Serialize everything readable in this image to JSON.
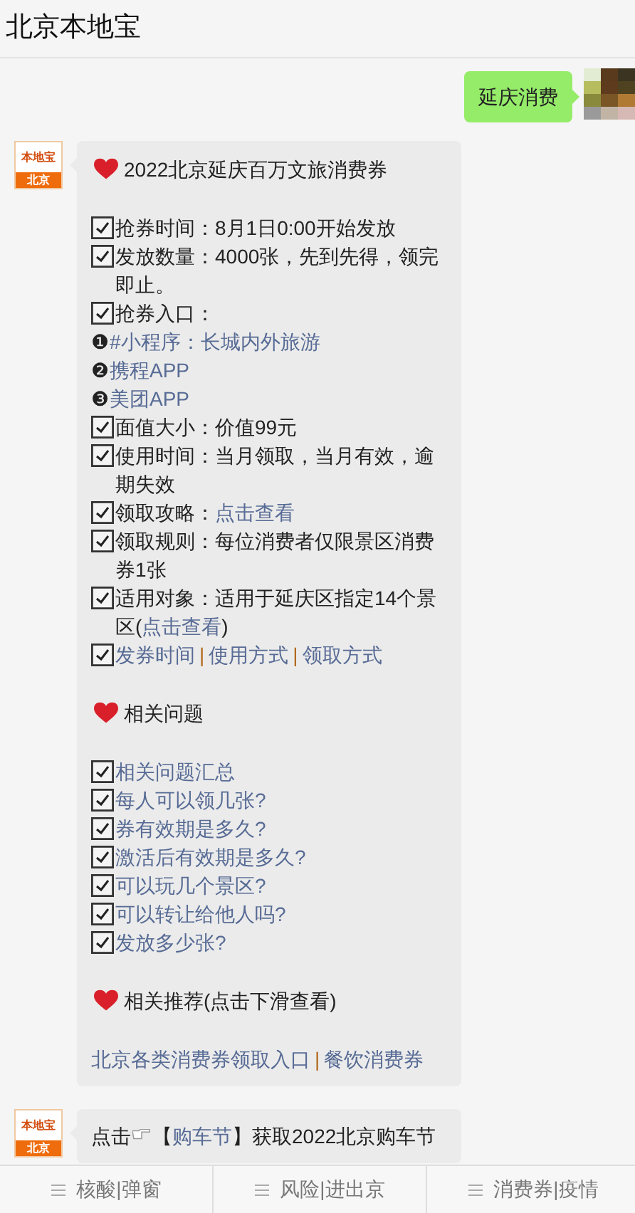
{
  "header": {
    "title": "北京本地宝"
  },
  "messages": [
    {
      "kind": "outgoing",
      "text": "延庆消费"
    },
    {
      "kind": "incoming",
      "logo": {
        "top": "本地宝",
        "bottom": "北京"
      },
      "lines": [
        {
          "kind": "heading",
          "parts": [
            {
              "kind": "text",
              "text": "2022北京延庆百万文旅消费券"
            }
          ]
        },
        {
          "kind": "blank"
        },
        {
          "kind": "check",
          "parts": [
            {
              "kind": "text",
              "text": "抢券时间：8月1日0:00开始发放"
            }
          ]
        },
        {
          "kind": "check",
          "parts": [
            {
              "kind": "text",
              "text": "发放数量：4000张，先到先得，领完即止。"
            }
          ]
        },
        {
          "kind": "check",
          "parts": [
            {
              "kind": "text",
              "text": "抢券入口："
            }
          ]
        },
        {
          "kind": "plain",
          "parts": [
            {
              "kind": "text",
              "text": "❶"
            },
            {
              "kind": "link",
              "text": "#小程序：长城内外旅游"
            }
          ]
        },
        {
          "kind": "plain",
          "parts": [
            {
              "kind": "text",
              "text": "❷"
            },
            {
              "kind": "link",
              "text": "携程APP"
            }
          ]
        },
        {
          "kind": "plain",
          "parts": [
            {
              "kind": "text",
              "text": "❸"
            },
            {
              "kind": "link",
              "text": "美团APP"
            }
          ]
        },
        {
          "kind": "check",
          "parts": [
            {
              "kind": "text",
              "text": "面值大小：价值99元"
            }
          ]
        },
        {
          "kind": "check",
          "parts": [
            {
              "kind": "text",
              "text": "使用时间：当月领取，当月有效，逾期失效"
            }
          ]
        },
        {
          "kind": "check",
          "parts": [
            {
              "kind": "text",
              "text": "领取攻略："
            },
            {
              "kind": "link",
              "text": "点击查看"
            }
          ]
        },
        {
          "kind": "check",
          "parts": [
            {
              "kind": "text",
              "text": "领取规则：每位消费者仅限景区消费券1张"
            }
          ]
        },
        {
          "kind": "check",
          "parts": [
            {
              "kind": "text",
              "text": "适用对象：适用于延庆区指定14个景区("
            },
            {
              "kind": "link",
              "text": "点击查看"
            },
            {
              "kind": "text",
              "text": ")"
            }
          ]
        },
        {
          "kind": "check",
          "parts": [
            {
              "kind": "link",
              "text": "发券时间"
            },
            {
              "kind": "sep",
              "text": "|"
            },
            {
              "kind": "link",
              "text": "使用方式"
            },
            {
              "kind": "sep",
              "text": "|"
            },
            {
              "kind": "link",
              "text": "领取方式"
            }
          ]
        },
        {
          "kind": "blank"
        },
        {
          "kind": "heading",
          "parts": [
            {
              "kind": "text",
              "text": "相关问题"
            }
          ]
        },
        {
          "kind": "blank"
        },
        {
          "kind": "check",
          "parts": [
            {
              "kind": "link",
              "text": "相关问题汇总"
            }
          ]
        },
        {
          "kind": "check",
          "parts": [
            {
              "kind": "link",
              "text": "每人可以领几张?"
            }
          ]
        },
        {
          "kind": "check",
          "parts": [
            {
              "kind": "link",
              "text": "券有效期是多久?"
            }
          ]
        },
        {
          "kind": "check",
          "parts": [
            {
              "kind": "link",
              "text": "激活后有效期是多久?"
            }
          ]
        },
        {
          "kind": "check",
          "parts": [
            {
              "kind": "link",
              "text": "可以玩几个景区?"
            }
          ]
        },
        {
          "kind": "check",
          "parts": [
            {
              "kind": "link",
              "text": "可以转让给他人吗?"
            }
          ]
        },
        {
          "kind": "check",
          "parts": [
            {
              "kind": "link",
              "text": "发放多少张?"
            }
          ]
        },
        {
          "kind": "blank"
        },
        {
          "kind": "heading",
          "parts": [
            {
              "kind": "text",
              "text": "相关推荐(点击下滑查看)"
            }
          ]
        },
        {
          "kind": "blank"
        },
        {
          "kind": "plain",
          "parts": [
            {
              "kind": "link",
              "text": "北京各类消费券领取入口"
            },
            {
              "kind": "sep",
              "text": "|"
            },
            {
              "kind": "link",
              "text": "餐饮消费券"
            }
          ]
        }
      ]
    },
    {
      "kind": "incoming",
      "logo": {
        "top": "本地宝",
        "bottom": "北京"
      },
      "lines": [
        {
          "kind": "plain",
          "parts": [
            {
              "kind": "text",
              "text": "点击"
            },
            {
              "kind": "hand"
            },
            {
              "kind": "text",
              "text": "【"
            },
            {
              "kind": "link",
              "text": "购车节"
            },
            {
              "kind": "text",
              "text": "】获取2022北京购车节"
            }
          ]
        }
      ]
    }
  ],
  "tabs": [
    {
      "label": "核酸|弹窗"
    },
    {
      "label": "风险|进出京"
    },
    {
      "label": "消费券|疫情"
    }
  ]
}
